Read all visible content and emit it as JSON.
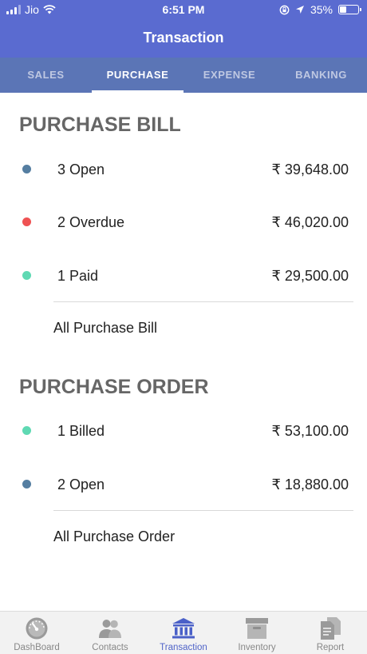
{
  "status_bar": {
    "carrier": "Jio",
    "time": "6:51 PM",
    "battery": "35%"
  },
  "header": {
    "title": "Transaction"
  },
  "tabs": [
    {
      "label": "SALES",
      "active": false
    },
    {
      "label": "PURCHASE",
      "active": true
    },
    {
      "label": "EXPENSE",
      "active": false
    },
    {
      "label": "BANKING",
      "active": false
    }
  ],
  "purchase_bill": {
    "title": "PURCHASE BILL",
    "rows": [
      {
        "label": "3 Open",
        "amount": "₹ 39,648.00",
        "color": "#557ea1"
      },
      {
        "label": "2 Overdue",
        "amount": "₹ 46,020.00",
        "color": "#ef5253"
      },
      {
        "label": "1 Paid",
        "amount": "₹ 29,500.00",
        "color": "#5fd9b3"
      }
    ],
    "link": "All Purchase Bill"
  },
  "purchase_order": {
    "title": "PURCHASE ORDER",
    "rows": [
      {
        "label": "1 Billed",
        "amount": "₹ 53,100.00",
        "color": "#5fd9b3"
      },
      {
        "label": "2 Open",
        "amount": "₹ 18,880.00",
        "color": "#557ea1"
      }
    ],
    "link": "All Purchase Order"
  },
  "bottom_nav": [
    {
      "label": "DashBoard",
      "icon": "gauge-icon",
      "active": false
    },
    {
      "label": "Contacts",
      "icon": "contacts-icon",
      "active": false
    },
    {
      "label": "Transaction",
      "icon": "bank-icon",
      "active": true
    },
    {
      "label": "Inventory",
      "icon": "archive-box-icon",
      "active": false
    },
    {
      "label": "Report",
      "icon": "report-icon",
      "active": false
    }
  ],
  "colors": {
    "header": "#5a6bd0",
    "tab_bar": "#5b75b6",
    "nav_active": "#5064c8",
    "nav_inactive": "#8a8a8a"
  }
}
